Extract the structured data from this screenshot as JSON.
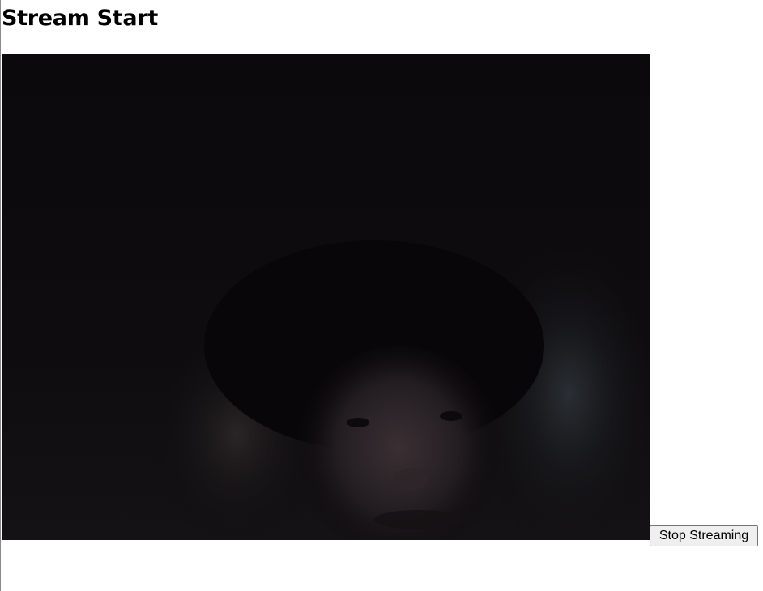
{
  "page": {
    "heading": "Stream Start"
  },
  "video": {
    "feed": "webcam-stream"
  },
  "controls": {
    "stop_label": "Stop Streaming"
  }
}
